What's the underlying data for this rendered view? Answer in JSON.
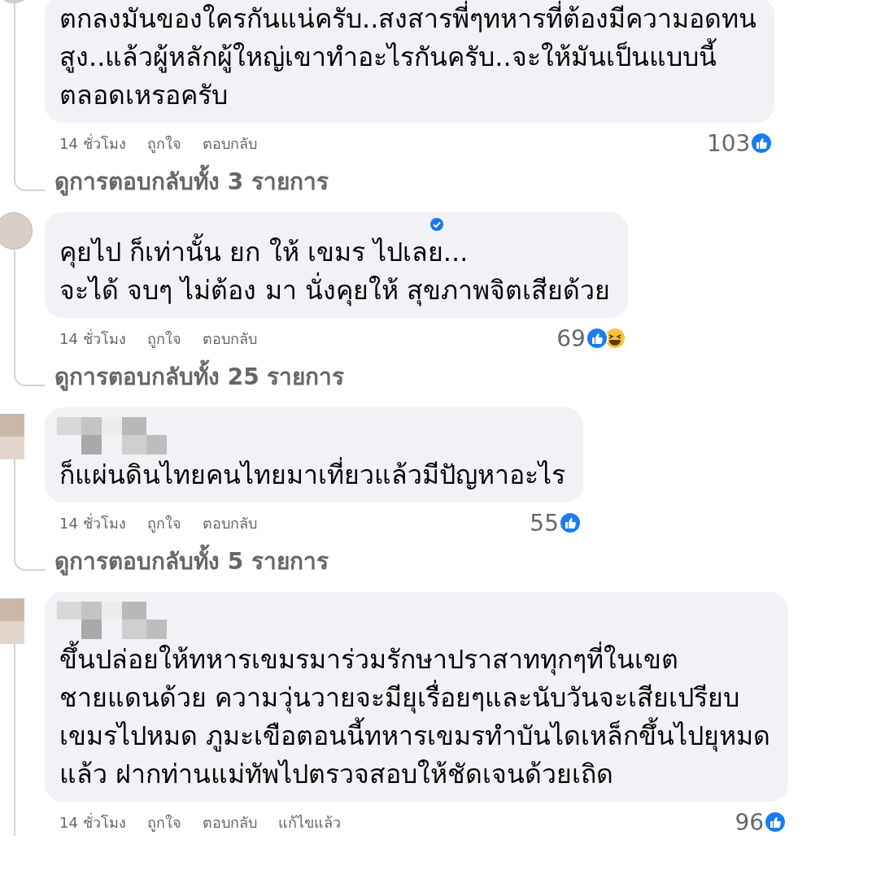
{
  "comments": [
    {
      "text": "ตกลงมันของใครกันแน่ครับ..สงสารพี่ๆทหารที่ต้องมีความอดทน\nสูง..แล้วผู้หลักผู้ใหญ่เขาทำอะไรกันครับ..จะให้มันเป็นแบบนี้\nตลอดเหรอครับ",
      "time": "14 ชั่วโมง",
      "like": "ถูกใจ",
      "reply": "ตอบกลับ",
      "count": "103",
      "reactions": [
        {
          "kind": "like"
        }
      ],
      "view_replies": "ดูการตอบกลับทั้ง 3 รายการ"
    },
    {
      "verified": true,
      "text": "คุยไป ก็เท่านั้น ยก ให้ เขมร ไปเลย...\nจะได้ จบๆ ไม่ต้อง มา นั่งคุยให้ สุขภาพจิตเสียด้วย",
      "time": "14 ชั่วโมง",
      "like": "ถูกใจ",
      "reply": "ตอบกลับ",
      "count": "69",
      "reactions": [
        {
          "kind": "like"
        },
        {
          "kind": "haha"
        }
      ],
      "view_replies": "ดูการตอบกลับทั้ง 25 รายการ"
    },
    {
      "obscured": true,
      "text": "ก็แผ่นดินไทยคนไทยมาเที่ยวแล้วมีปัญหาอะไร",
      "time": "14 ชั่วโมง",
      "like": "ถูกใจ",
      "reply": "ตอบกลับ",
      "count": "55",
      "reactions": [
        {
          "kind": "like"
        }
      ],
      "view_replies": "ดูการตอบกลับทั้ง 5 รายการ"
    },
    {
      "obscured": true,
      "text": "ขึ้นปล่อยให้ทหารเขมรมาร่วมรักษาปราสาททุกๆที่ในเขต\nชายแดนด้วย ความวุ่นวายจะมียุเรื่อยๆและนับวันจะเสียเปรียบ\nเขมรไปหมด ภูมะเขือตอนนี้ทหารเขมรทำบันไดเหล็กขึ้นไปยุหมด\nแล้ว ฝากท่านแม่ทัพไปตรวจสอบให้ชัดเจนด้วยเถิด",
      "time": "14 ชั่วโมง",
      "like": "ถูกใจ",
      "reply": "ตอบกลับ",
      "edited": "แก้ไขแล้ว",
      "count": "96",
      "reactions": [
        {
          "kind": "like"
        }
      ]
    }
  ]
}
